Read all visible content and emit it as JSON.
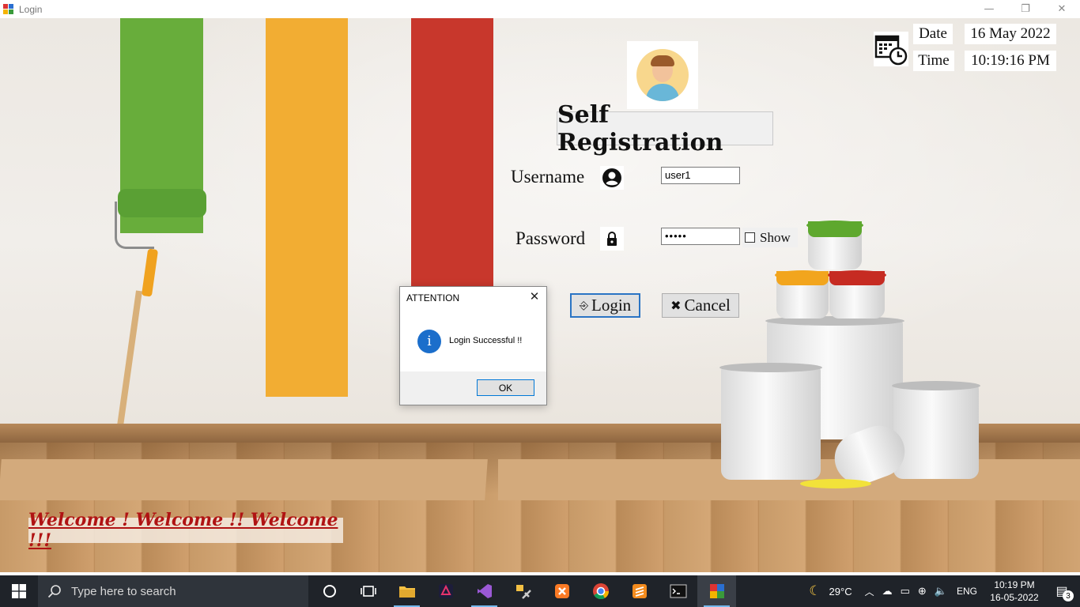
{
  "window": {
    "title": "Login",
    "controls": {
      "minimize": "—",
      "restore": "❐",
      "close": "✕"
    }
  },
  "form": {
    "heading": "Self Registration",
    "username_label": "Username",
    "username_value": "user1",
    "password_label": "Password",
    "password_value": "•••••",
    "show_label": "Show",
    "login_label": "Login",
    "cancel_label": "Cancel",
    "date_label": "Date",
    "date_value": "16 May 2022",
    "time_label": "Time",
    "time_value": "10:19:16 PM",
    "welcome_text": "Welcome ! Welcome !! Welcome !!!"
  },
  "dialog": {
    "title": "ATTENTION",
    "message": "Login Successful !!",
    "ok_label": "OK",
    "icon": "info-icon"
  },
  "taskbar": {
    "search_placeholder": "Type here to search",
    "apps": [
      "cortana-icon",
      "task-view-icon",
      "file-explorer-icon",
      "app-icon",
      "visual-studio-icon",
      "tools-icon",
      "xampp-icon",
      "chrome-icon",
      "sublime-icon",
      "terminal-icon",
      "login-app-icon"
    ],
    "weather": "29°C",
    "language": "ENG",
    "time": "10:19 PM",
    "date": "16-05-2022",
    "notification_count": "3"
  },
  "colors": {
    "green_stripe": "#68ad3b",
    "orange_stripe": "#f2ad33",
    "red_stripe": "#c8372c",
    "welcome_text": "#b01313",
    "accent": "#0078d7"
  }
}
